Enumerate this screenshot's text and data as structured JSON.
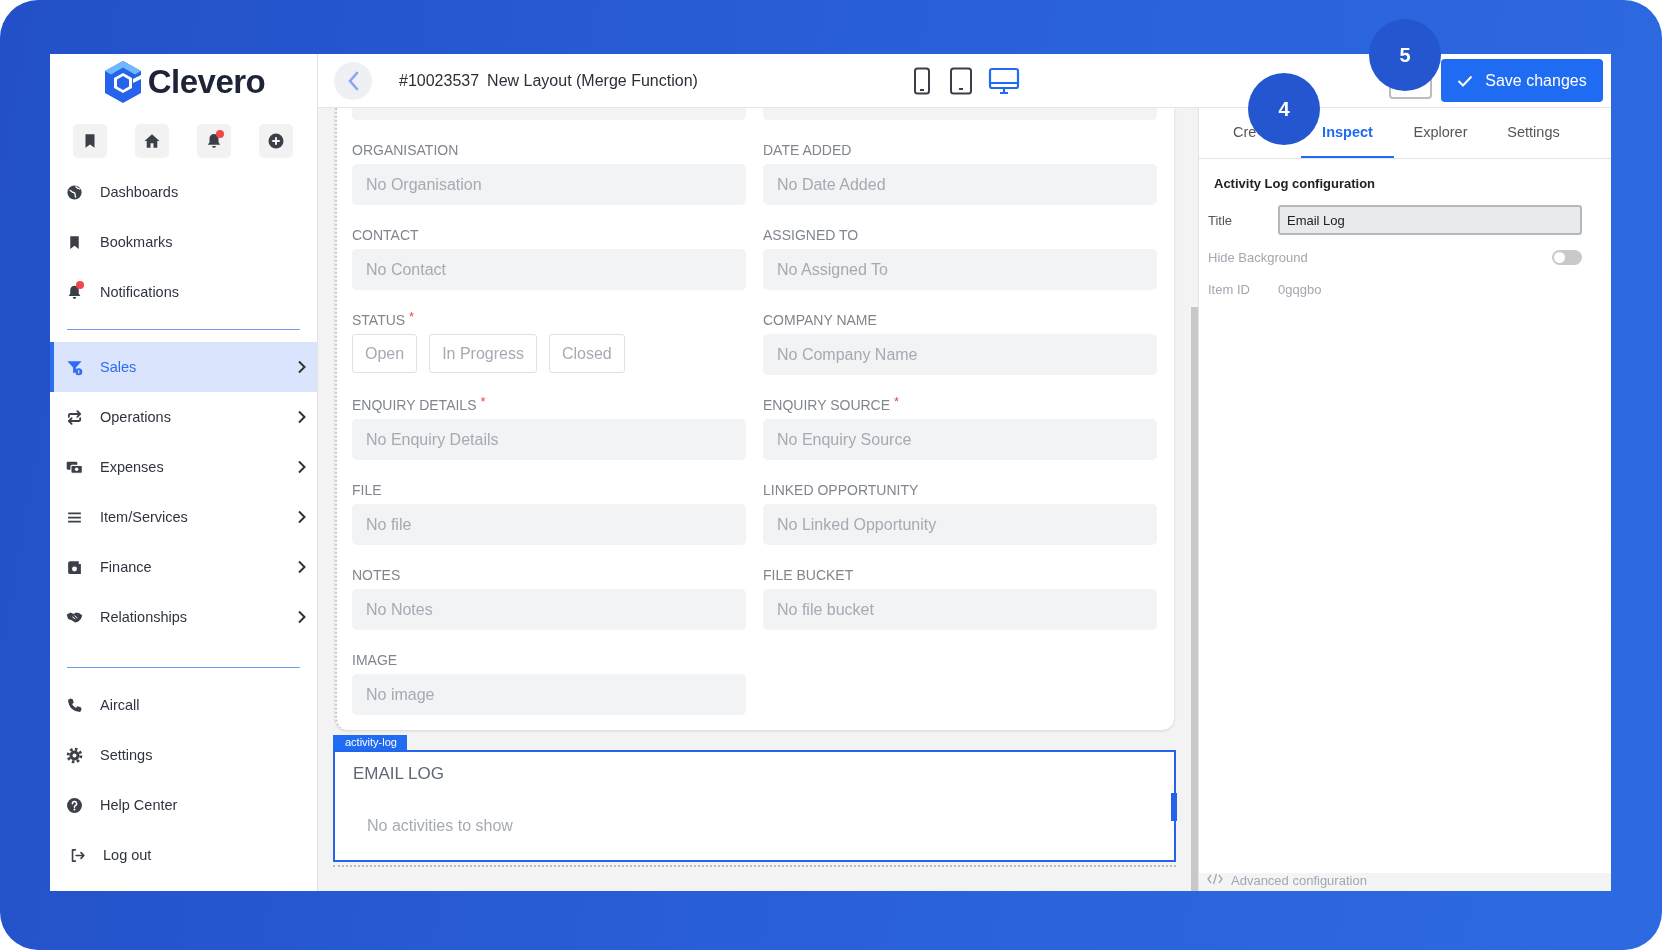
{
  "sidebar": {
    "logo": "Clevero",
    "quick_actions": [
      {
        "kind": "bookmark",
        "badge": false
      },
      {
        "kind": "home",
        "badge": false
      },
      {
        "kind": "bell",
        "badge": true
      },
      {
        "kind": "plus",
        "badge": false
      }
    ],
    "top_items": [
      {
        "label": "Dashboards",
        "kind": "dashboard",
        "badge": false
      },
      {
        "label": "Bookmarks",
        "kind": "bookmark",
        "badge": false
      },
      {
        "label": "Notifications",
        "kind": "bell",
        "badge": true
      }
    ],
    "items": [
      {
        "label": "Sales",
        "kind": "funnel",
        "selected": true
      },
      {
        "label": "Operations",
        "kind": "arrows",
        "selected": false
      },
      {
        "label": "Expenses",
        "kind": "money",
        "selected": false
      },
      {
        "label": "Item/Services",
        "kind": "list",
        "selected": false
      },
      {
        "label": "Finance",
        "kind": "wallet",
        "selected": false
      },
      {
        "label": "Relationships",
        "kind": "handshake",
        "selected": false
      }
    ],
    "bottom_items": [
      {
        "label": "Aircall",
        "kind": "phone"
      },
      {
        "label": "Settings",
        "kind": "gear"
      },
      {
        "label": "Help Center",
        "kind": "help"
      },
      {
        "label": "Log out",
        "kind": "logout"
      }
    ]
  },
  "header": {
    "record_id": "#10023537",
    "title": "New Layout (Merge Function)",
    "devices": [
      {
        "kind": "phone",
        "selected": false
      },
      {
        "kind": "tablet",
        "selected": false
      },
      {
        "kind": "desktop",
        "selected": true
      }
    ],
    "save_button": "Save changes"
  },
  "form": {
    "fields": [
      {
        "kind": "input",
        "label": "ORGANISATION",
        "placeholder": "No Organisation"
      },
      {
        "kind": "input",
        "label": "DATE ADDED",
        "placeholder": "No Date Added"
      },
      {
        "kind": "input",
        "label": "CONTACT",
        "placeholder": "No Contact"
      },
      {
        "kind": "input",
        "label": "ASSIGNED TO",
        "placeholder": "No Assigned To"
      },
      {
        "kind": "options",
        "label": "STATUS $^{*}$",
        "options": [
          {
            "label": "Open",
            "selected": false
          },
          {
            "label": "In Progress",
            "selected": false
          },
          {
            "label": "Closed",
            "selected": false
          }
        ]
      },
      {
        "kind": "input",
        "label": "COMPANY NAME",
        "placeholder": "No Company Name"
      },
      {
        "kind": "input",
        "label": "ENQUIRY DETAILS $^{*}$",
        "placeholder": "No Enquiry Details"
      },
      {
        "kind": "input",
        "label": "ENQUIRY SOURCE $^{*}$",
        "placeholder": "No Enquiry Source"
      },
      {
        "kind": "input",
        "label": "FILE",
        "placeholder": "No file"
      },
      {
        "kind": "input",
        "label": "LINKED OPPORTUNITY",
        "placeholder": "No Linked Opportunity"
      },
      {
        "kind": "input",
        "label": "NOTES",
        "placeholder": "No Notes"
      },
      {
        "kind": "input",
        "label": "FILE BUCKET",
        "placeholder": "No file bucket"
      },
      {
        "kind": "input",
        "label": "IMAGE",
        "placeholder": "No image"
      }
    ]
  },
  "activity_log": {
    "tag": "activity-log",
    "title": "EMAIL LOG",
    "empty_text": "No activities to show"
  },
  "panel": {
    "tabs": [
      {
        "label": "Cre",
        "selected": false
      },
      {
        "label": "Inspect",
        "selected": true
      },
      {
        "label": "Explorer",
        "selected": false
      },
      {
        "label": "Settings",
        "selected": false
      }
    ],
    "section_title": "Activity Log configuration",
    "title_label": "Title",
    "title_value": "Email Log",
    "hide_background": {
      "label": "Hide Background",
      "on": false
    },
    "item_id": {
      "label": "Item ID",
      "value": "0gqgbo"
    },
    "advanced": "Advanced configuration"
  },
  "callouts": [
    {
      "label": "4"
    },
    {
      "label": "5"
    }
  ]
}
